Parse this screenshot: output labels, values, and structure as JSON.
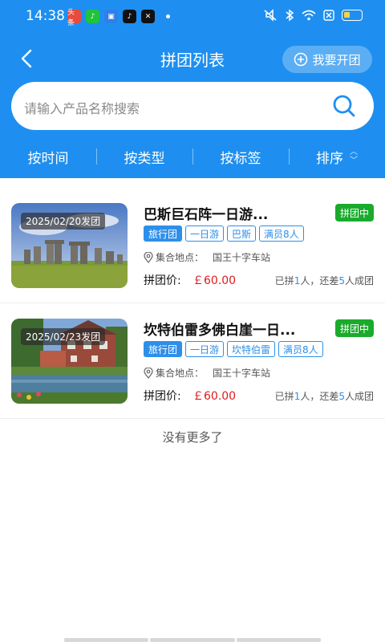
{
  "status_bar": {
    "time": "14:38",
    "apps": [
      {
        "name": "toutiao-app-icon",
        "label": "头条",
        "color": "#e84a3d"
      },
      {
        "name": "music-app-icon",
        "label": "♪",
        "color": "#1ec43a"
      },
      {
        "name": "folder-app-icon",
        "label": "▣",
        "color": "#2f7fe8"
      },
      {
        "name": "tiktok-app-icon",
        "label": "♪",
        "color": "#111111"
      },
      {
        "name": "capcut-app-icon",
        "label": "✕",
        "color": "#111111"
      }
    ],
    "battery_color": "#f4d34c"
  },
  "nav": {
    "title": "拼团列表",
    "open_label": "我要开团"
  },
  "search": {
    "placeholder": "请输入产品名称搜索"
  },
  "filters": [
    {
      "label": "按时间"
    },
    {
      "label": "按类型"
    },
    {
      "label": "按标签"
    },
    {
      "label": "排序"
    }
  ],
  "items": [
    {
      "date": "2025/02/20发团",
      "title": "巴斯巨石阵一日游...",
      "status": "拼团中",
      "tags": [
        "旅行团",
        "一日游",
        "巴斯",
        "满员8人"
      ],
      "location_label": "集合地点：",
      "location": "国王十字车站",
      "price_label": "拼团价:",
      "price": "￡60.00",
      "joined_prefix": "已拼",
      "joined": "1",
      "joined_mid": "人，还差",
      "missing": "5",
      "missing_suffix": "人成团"
    },
    {
      "date": "2025/02/23发团",
      "title": "坎特伯雷多佛白崖一日...",
      "status": "拼团中",
      "tags": [
        "旅行团",
        "一日游",
        "坎特伯雷",
        "满员8人"
      ],
      "location_label": "集合地点：",
      "location": "国王十字车站",
      "price_label": "拼团价:",
      "price": "￡60.00",
      "joined_prefix": "已拼",
      "joined": "1",
      "joined_mid": "人，还差",
      "missing": "5",
      "missing_suffix": "人成团"
    }
  ],
  "footer": {
    "no_more": "没有更多了"
  },
  "colors": {
    "brand": "#1e8ff0",
    "tag": "#2d8fea",
    "status_green": "#1aab2c",
    "price_red": "#e01b1b"
  }
}
